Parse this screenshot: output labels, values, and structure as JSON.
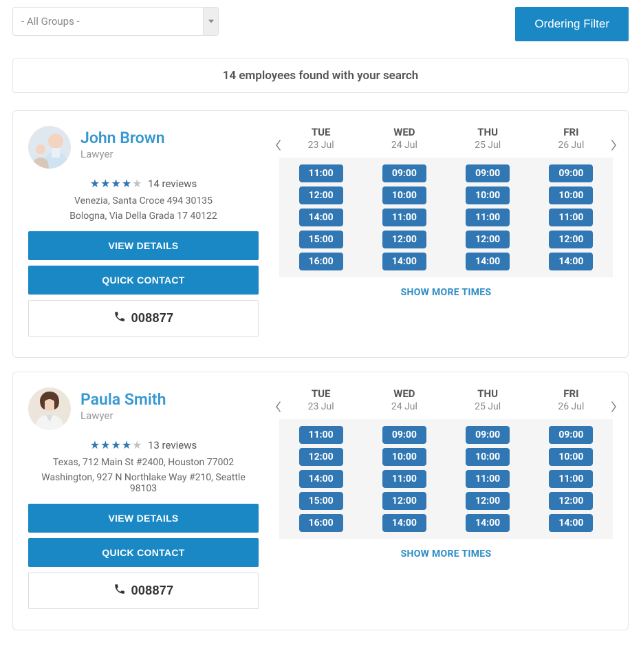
{
  "filter": {
    "group_select": "- All Groups -",
    "ordering_btn": "Ordering Filter"
  },
  "results_msg": "14 employees found with your search",
  "days": [
    {
      "name": "TUE",
      "date": "23 Jul",
      "slots": [
        "11:00",
        "12:00",
        "14:00",
        "15:00",
        "16:00"
      ]
    },
    {
      "name": "WED",
      "date": "24 Jul",
      "slots": [
        "09:00",
        "10:00",
        "11:00",
        "12:00",
        "14:00"
      ]
    },
    {
      "name": "THU",
      "date": "25 Jul",
      "slots": [
        "09:00",
        "10:00",
        "11:00",
        "12:00",
        "14:00"
      ]
    },
    {
      "name": "FRI",
      "date": "26 Jul",
      "slots": [
        "09:00",
        "10:00",
        "11:00",
        "12:00",
        "14:00"
      ]
    }
  ],
  "labels": {
    "view_details": "VIEW DETAILS",
    "quick_contact": "QUICK CONTACT",
    "show_more": "SHOW MORE TIMES"
  },
  "employees": [
    {
      "name": "John Brown",
      "role": "Lawyer",
      "rating": 4,
      "reviews": "14 reviews",
      "locations": [
        "Venezia, Santa Croce 494 30135",
        "Bologna, Via Della Grada 17 40122"
      ],
      "phone": "008877"
    },
    {
      "name": "Paula Smith",
      "role": "Lawyer",
      "rating": 4,
      "reviews": "13 reviews",
      "locations": [
        "Texas, 712 Main St #2400, Houston 77002",
        "Washington, 927 N Northlake Way #210, Seattle 98103"
      ],
      "phone": "008877"
    }
  ]
}
